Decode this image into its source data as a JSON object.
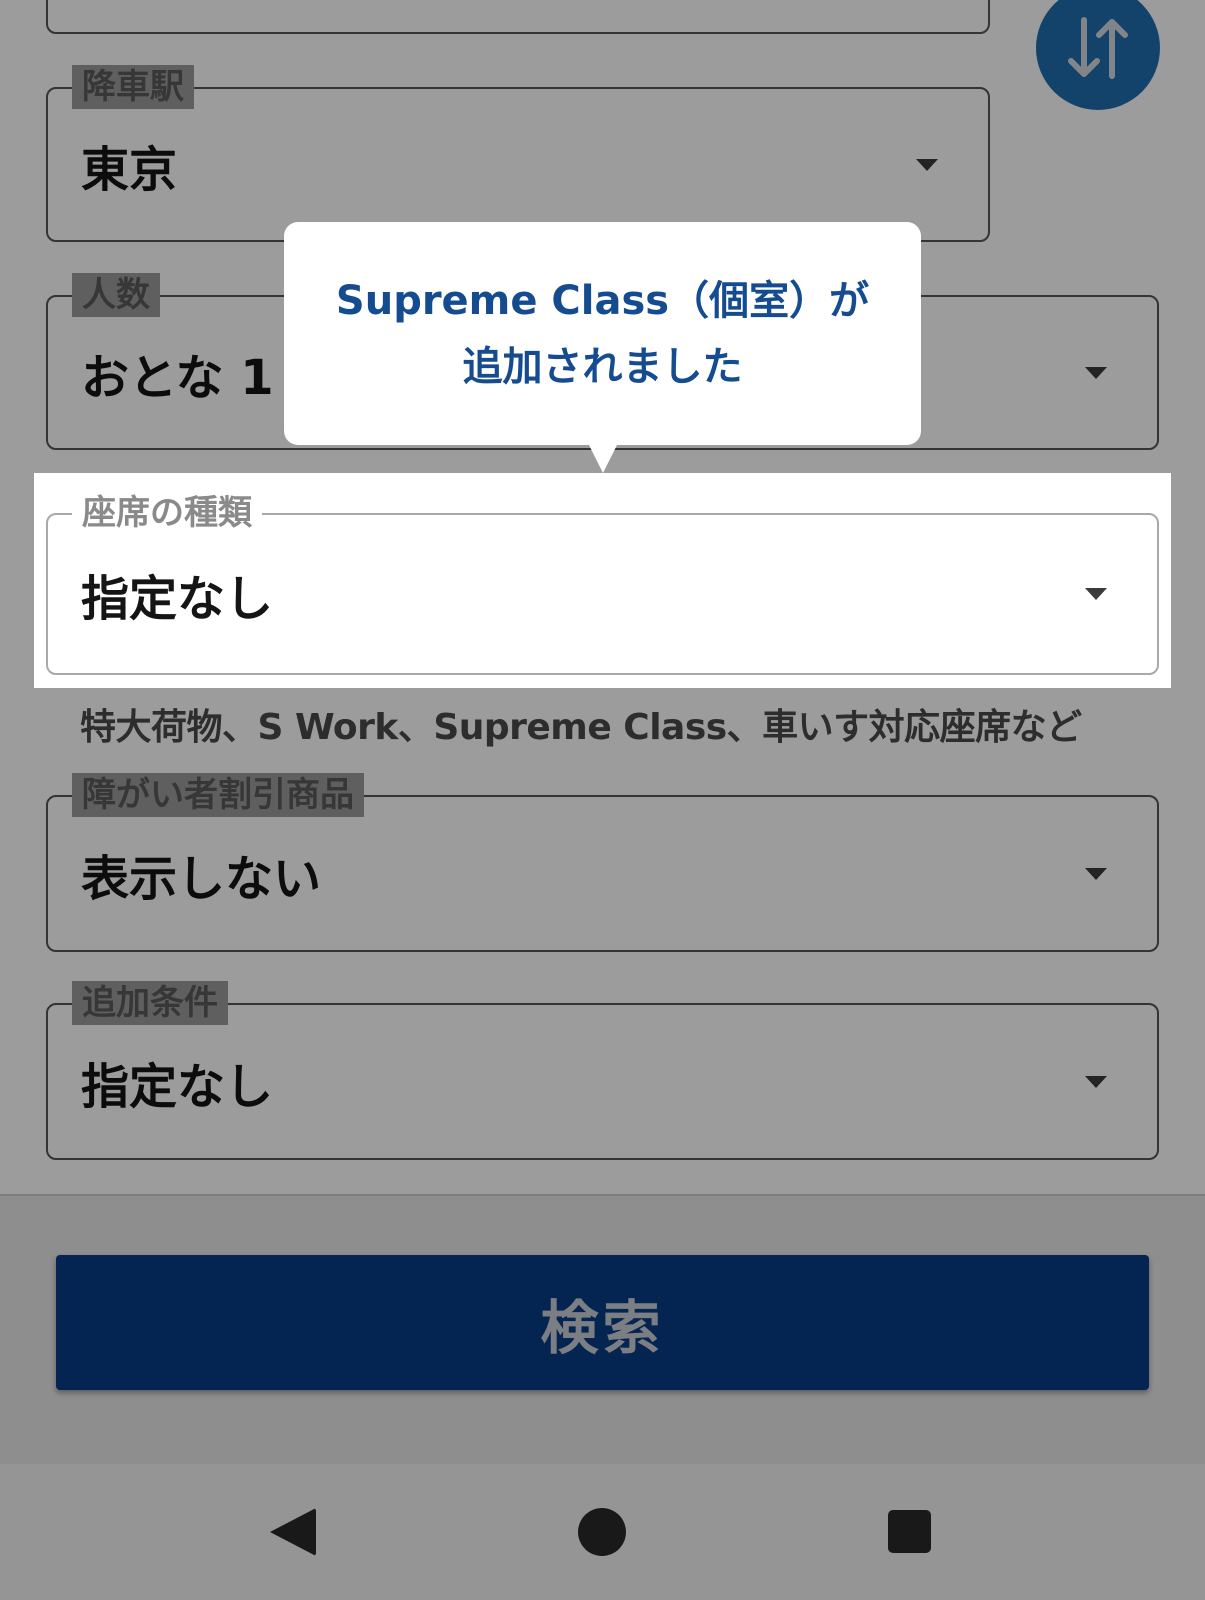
{
  "form": {
    "arrival_station": {
      "label": "降車駅",
      "value": "東京"
    },
    "passengers": {
      "label": "人数",
      "value": "おとな 1"
    },
    "seat_type": {
      "label": "座席の種類",
      "value": "指定なし"
    },
    "seat_type_helper": "特大荷物、S Work、Supreme Class、車いす対応座席など",
    "disability_discount": {
      "label": "障がい者割引商品",
      "value": "表示しない"
    },
    "additional_conditions": {
      "label": "追加条件",
      "value": "指定なし"
    }
  },
  "tooltip": {
    "line1": "Supreme Class（個室）が",
    "line2": "追加されました"
  },
  "search_button": {
    "label": "検索"
  },
  "icons": {
    "swap": "swap-vertical-icon",
    "caret": "caret-down-icon",
    "nav_back": "nav-back-icon",
    "nav_home": "nav-home-icon",
    "nav_recents": "nav-recents-icon"
  },
  "colors": {
    "primary": "#083c86",
    "swap_button": "#1f6db0",
    "tooltip_text": "#154b8f",
    "scrim": "rgba(0,0,0,0.39)"
  }
}
